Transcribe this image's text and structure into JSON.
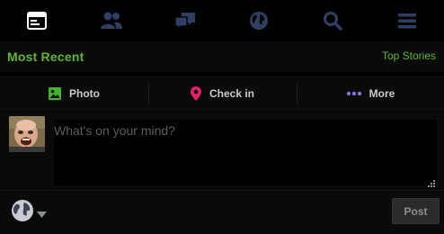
{
  "nav": {
    "items": [
      {
        "icon": "newsfeed-icon",
        "active": true
      },
      {
        "icon": "friends-icon",
        "active": false
      },
      {
        "icon": "messages-icon",
        "active": false
      },
      {
        "icon": "globe-notifications-icon",
        "active": false
      },
      {
        "icon": "search-icon",
        "active": false
      },
      {
        "icon": "menu-icon",
        "active": false
      }
    ],
    "active_color": "#ffffff",
    "inactive_color": "#2f3e63"
  },
  "feed_filter": {
    "current_label": "Most Recent",
    "switch_label": "Top Stories",
    "accent_color": "#5fb828"
  },
  "composer": {
    "actions": [
      {
        "label": "Photo",
        "icon": "photo-icon",
        "color": "#42b72a"
      },
      {
        "label": "Check in",
        "icon": "location-pin-icon",
        "color": "#e4206b"
      },
      {
        "label": "More",
        "icon": "more-dots-icon",
        "color": "#8c72cb"
      }
    ],
    "placeholder": "What's on your mind?",
    "value": "",
    "privacy_icon": "globe-icon",
    "post_label": "Post"
  }
}
